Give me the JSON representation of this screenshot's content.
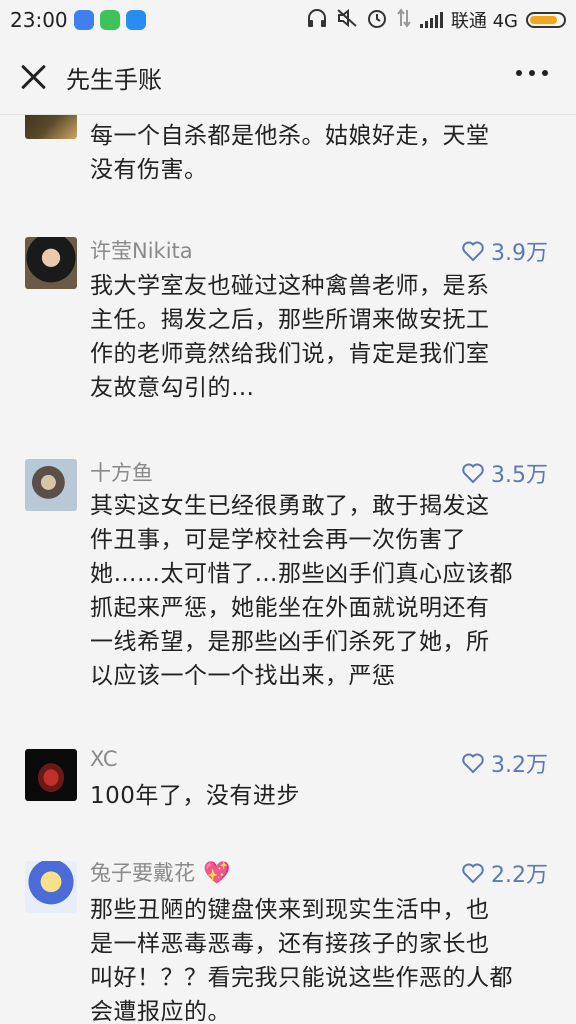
{
  "status_bar": {
    "time": "23:00",
    "carrier": "联通 4G",
    "battery_level": 0.85,
    "battery_color": "#f3a51b",
    "icons": [
      "k-app-icon",
      "cat-app-icon",
      "square-app-icon",
      "headphones-icon",
      "mute-icon",
      "alarm-icon",
      "data-arrows-icon",
      "signal-icon",
      "battery-icon"
    ]
  },
  "header": {
    "title": "先生手账",
    "close_icon": "close-icon",
    "more_icon": "more-dots-icon"
  },
  "comments": [
    {
      "name": "",
      "likes": "",
      "lines": [
        "每一个自杀都是他杀。姑娘好走，天堂",
        "没有伤害。"
      ]
    },
    {
      "name": "许莹Nikita",
      "likes": "3.9万",
      "lines": [
        "我大学室友也碰过这种禽兽老师，是系",
        "主任。揭发之后，那些所谓来做安抚工",
        "作的老师竟然给我们说，肯定是我们室",
        "友故意勾引的…"
      ]
    },
    {
      "name": "十方鱼",
      "likes": "3.5万",
      "lines": [
        "其实这女生已经很勇敢了，敢于揭发这",
        "件丑事，可是学校社会再一次伤害了",
        "她……太可惜了…那些凶手们真心应该都",
        "抓起来严惩，她能坐在外面就说明还有",
        "一线希望，是那些凶手们杀死了她，所",
        "以应该一个一个找出来，严惩"
      ]
    },
    {
      "name": "XC",
      "likes": "3.2万",
      "lines": [
        "100年了，没有进步"
      ]
    },
    {
      "name": "兔子要戴花",
      "badge": "💖",
      "likes": "2.2万",
      "lines": [
        "那些丑陋的键盘侠来到现实生活中，也",
        "是一样恶毒恶毒，还有接孩子的家长也",
        "叫好！？？看完我只能说这些作恶的人都",
        "会遭报应的。"
      ]
    }
  ],
  "colors": {
    "like_color": "#5b7bb0",
    "name_color": "#8a8a8a",
    "background": "#f4f4f4"
  }
}
